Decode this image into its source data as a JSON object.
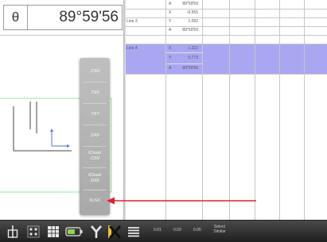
{
  "measurement": {
    "symbol": "θ",
    "value": "89°59'56"
  },
  "export_menu": {
    "items": [
      ".CSV",
      ".TSV",
      ".TXT",
      ".DXF",
      "iCloud\n.CSV",
      "iCloud\n.DXF",
      "XLSX"
    ]
  },
  "table": {
    "rows": [
      {
        "label": "",
        "axis": "A",
        "value": "89°59'59",
        "highlighted": false
      },
      {
        "label": "Line 3",
        "axis": "X",
        "value": "-0.555",
        "highlighted": false
      },
      {
        "label": "",
        "axis": "Y",
        "value": "1.092",
        "highlighted": false
      },
      {
        "label": "",
        "axis": "A",
        "value": "89°59'59",
        "highlighted": false
      },
      {
        "label": "Line 4",
        "axis": "X",
        "value": "-1.222",
        "highlighted": true
      },
      {
        "label": "",
        "axis": "Y",
        "value": "0.773",
        "highlighted": true
      },
      {
        "label": "",
        "axis": "A",
        "value": "89°59'56",
        "highlighted": true
      }
    ]
  },
  "toolbar": {
    "precision_1": "0.01",
    "precision_2": "0.02",
    "precision_3": "0.05",
    "select_similar_line1": "Select",
    "select_similar_line2": "Similar"
  },
  "colors": {
    "highlight": "#a9a7f2",
    "annotation": "#e0202a",
    "menu": "#b3b3b3",
    "toolbar": "#2e2e2e"
  },
  "icons": {
    "toolbar": [
      "measure-tool-icon",
      "grid-points-icon",
      "table-icon",
      "battery-icon",
      "y-axis-icon",
      "x-delete-icon",
      "list-icon"
    ]
  }
}
